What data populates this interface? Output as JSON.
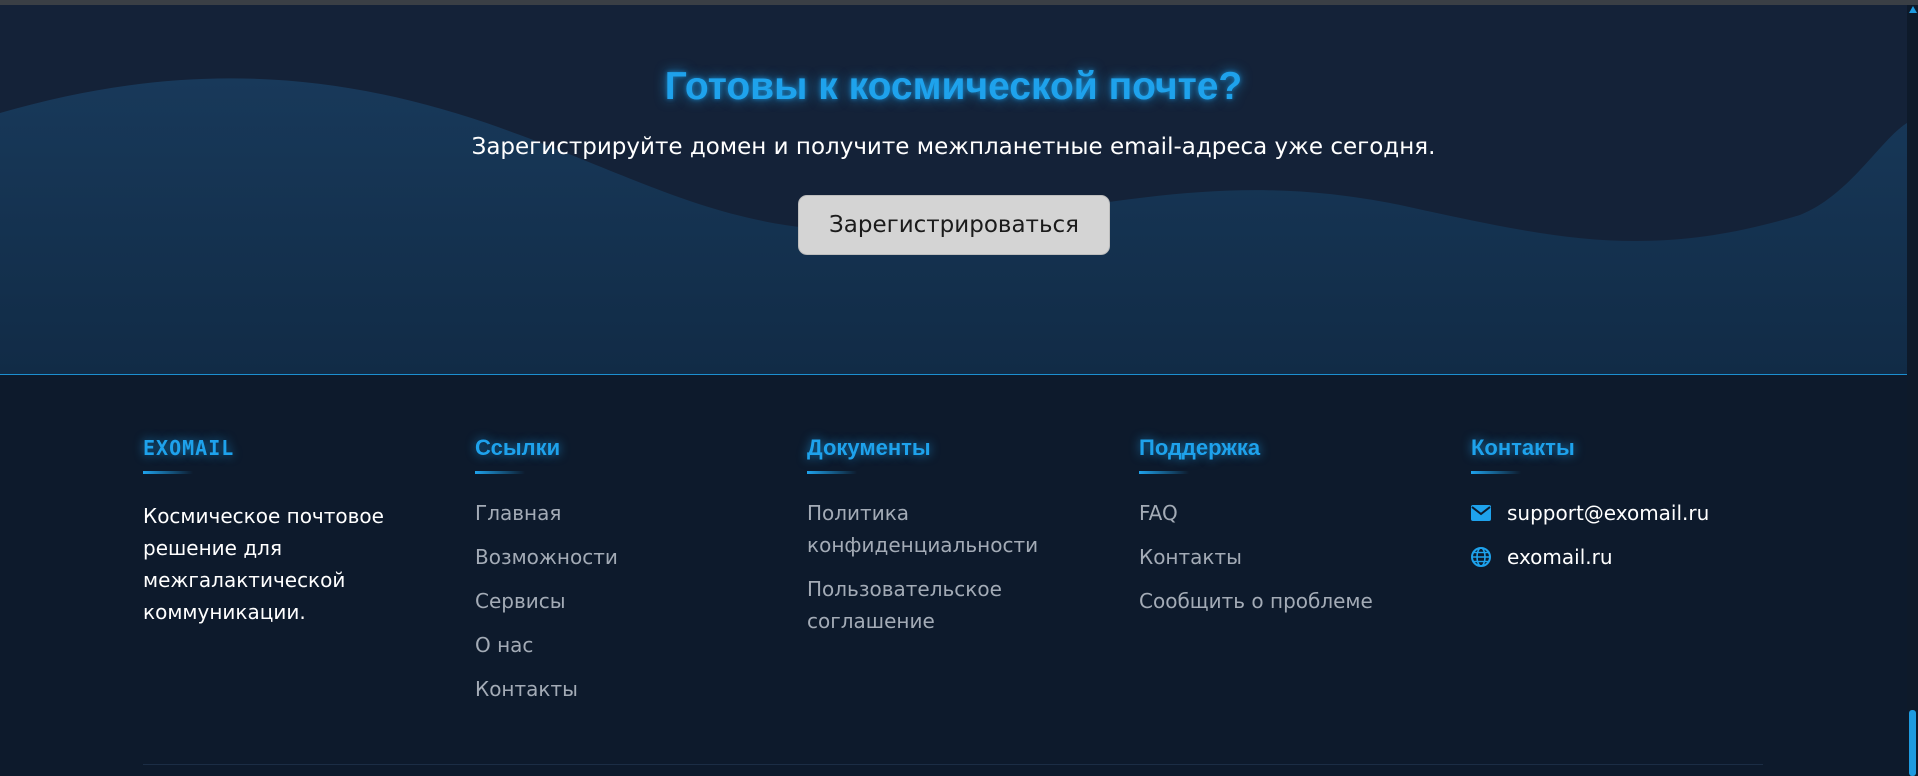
{
  "cta": {
    "title": "Готовы к космической почте?",
    "subtitle": "Зарегистрируйте домен и получите межпланетные email-адреса уже сегодня.",
    "button_label": "Зарегистрироваться"
  },
  "footer": {
    "brand": {
      "name": "EXOMAIL",
      "description": "Космическое почтовое решение для межгалактической коммуникации."
    },
    "links": {
      "heading": "Ссылки",
      "items": [
        "Главная",
        "Возможности",
        "Сервисы",
        "О нас",
        "Контакты"
      ]
    },
    "documents": {
      "heading": "Документы",
      "items": [
        "Политика конфиденциальности",
        "Пользовательское соглашение"
      ]
    },
    "support": {
      "heading": "Поддержка",
      "items": [
        "FAQ",
        "Контакты",
        "Сообщить о проблеме"
      ]
    },
    "contacts": {
      "heading": "Контакты",
      "email": "support@exomail.ru",
      "website": "exomail.ru",
      "email_icon": "envelope-icon",
      "website_icon": "globe-icon"
    }
  },
  "colors": {
    "accent": "#1ea2ec",
    "background": "#0d1a2c",
    "button": "#d4d4d4"
  }
}
